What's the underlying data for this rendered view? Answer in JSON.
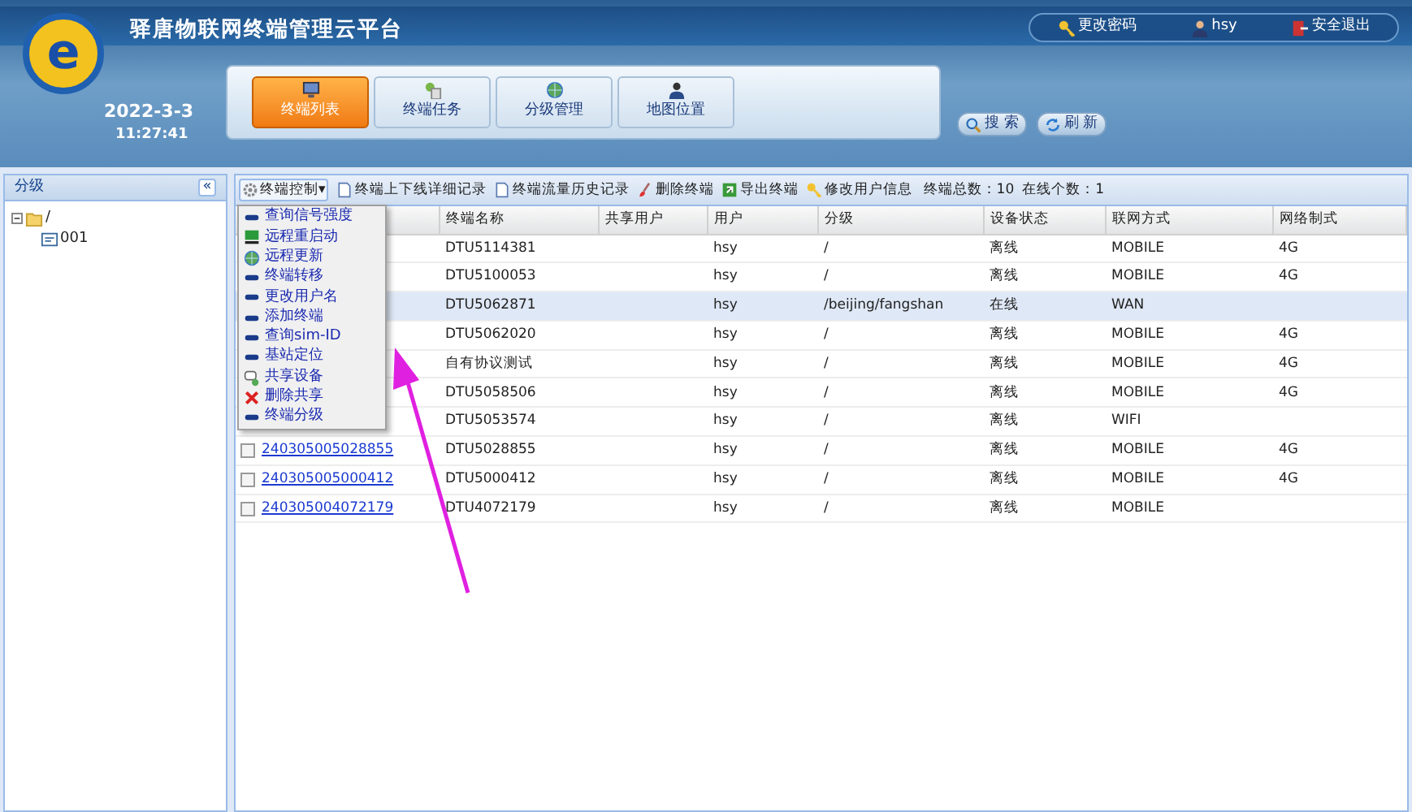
{
  "header": {
    "logo_letter": "e",
    "title": "驿唐物联网终端管理云平台",
    "date": "2022-3-3",
    "time": "11:27:41",
    "top_links": [
      {
        "kind": "key",
        "label": "更改密码"
      },
      {
        "kind": "user",
        "label": "hsy"
      },
      {
        "kind": "exit",
        "label": "安全退出"
      }
    ],
    "nav_tabs": [
      {
        "label": "终端列表",
        "selected": true,
        "kind": "list"
      },
      {
        "label": "终端任务",
        "selected": false,
        "kind": "task"
      },
      {
        "label": "分级管理",
        "selected": false,
        "kind": "globe"
      },
      {
        "label": "地图位置",
        "selected": false,
        "kind": "person"
      }
    ],
    "buttons": [
      {
        "kind": "search",
        "label": "搜 索"
      },
      {
        "kind": "refresh",
        "label": "刷 新"
      }
    ]
  },
  "sidebar": {
    "title": "分级",
    "collapse": "«",
    "tree": [
      {
        "label": "/",
        "expanded": true,
        "children": [
          {
            "label": "001"
          }
        ]
      }
    ]
  },
  "toolbar": {
    "items": [
      {
        "kind": "gear",
        "label": "终端控制▾"
      },
      {
        "kind": "doc",
        "label": "终端上下线详细记录"
      },
      {
        "kind": "doc",
        "label": "终端流量历史记录"
      },
      {
        "kind": "brush",
        "label": "删除终端"
      },
      {
        "kind": "export",
        "label": "导出终端"
      },
      {
        "kind": "key",
        "label": "修改用户信息"
      }
    ],
    "total": "终端总数：10",
    "online": "在线个数：1"
  },
  "menu": [
    {
      "kind": "bar",
      "label": "查询信号强度"
    },
    {
      "kind": "monitor",
      "label": "远程重启动"
    },
    {
      "kind": "globe",
      "label": "远程更新"
    },
    {
      "kind": "bar",
      "label": "终端转移"
    },
    {
      "kind": "bar",
      "label": "更改用户名"
    },
    {
      "kind": "bar",
      "label": "添加终端"
    },
    {
      "kind": "bar",
      "label": "查询sim-ID"
    },
    {
      "kind": "bar",
      "label": "基站定位"
    },
    {
      "kind": "share",
      "label": "共享设备"
    },
    {
      "kind": "cross",
      "label": "删除共享"
    },
    {
      "kind": "bar",
      "label": "终端分级"
    }
  ],
  "table": {
    "columns": [
      "终端名称",
      "共享用户",
      "用户",
      "分级",
      "设备状态",
      "联网方式",
      "网络制式"
    ],
    "rows": [
      {
        "selected": false,
        "cells": [
          "DTU5114381",
          "",
          "hsy",
          "/",
          "离线",
          "MOBILE",
          "4G"
        ]
      },
      {
        "selected": false,
        "cells": [
          "DTU5100053",
          "",
          "hsy",
          "/",
          "离线",
          "MOBILE",
          "4G"
        ]
      },
      {
        "selected": true,
        "cells": [
          "DTU5062871",
          "",
          "hsy",
          "/beijing/fangshan",
          "在线",
          "WAN",
          ""
        ]
      },
      {
        "selected": false,
        "cells": [
          "DTU5062020",
          "",
          "hsy",
          "/",
          "离线",
          "MOBILE",
          "4G"
        ]
      },
      {
        "selected": false,
        "cells": [
          "自有协议测试",
          "",
          "hsy",
          "/",
          "离线",
          "MOBILE",
          "4G"
        ]
      },
      {
        "selected": false,
        "cells": [
          "DTU5058506",
          "",
          "hsy",
          "/",
          "离线",
          "MOBILE",
          "4G"
        ]
      },
      {
        "selected": false,
        "cells": [
          "DTU5053574",
          "",
          "hsy",
          "/",
          "离线",
          "WIFI",
          ""
        ]
      },
      {
        "selected": false,
        "checked": false,
        "id": "240305005028855",
        "cells": [
          "DTU5028855",
          "",
          "hsy",
          "/",
          "离线",
          "MOBILE",
          "4G"
        ]
      },
      {
        "selected": false,
        "checked": false,
        "id": "240305005000412",
        "cells": [
          "DTU5000412",
          "",
          "hsy",
          "/",
          "离线",
          "MOBILE",
          "4G"
        ]
      },
      {
        "selected": false,
        "checked": false,
        "id": "240305004072179",
        "cells": [
          "DTU4072179",
          "",
          "hsy",
          "/",
          "离线",
          "MOBILE",
          ""
        ]
      }
    ]
  }
}
